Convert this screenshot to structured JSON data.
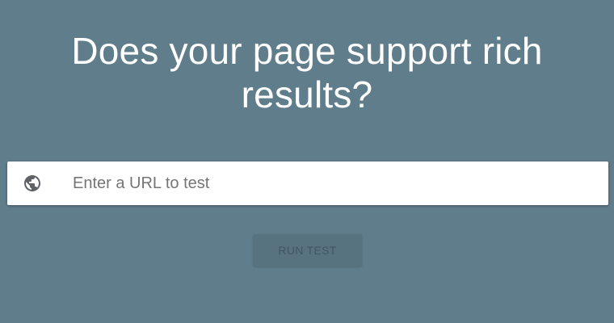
{
  "hero": {
    "title": "Does your page support rich results?"
  },
  "url_bar": {
    "icon": "globe-icon",
    "value": "",
    "placeholder": "Enter a URL to test"
  },
  "run_button": {
    "label": "RUN TEST",
    "state": "disabled"
  },
  "colors": {
    "background": "#607d8b",
    "input_background": "#ffffff",
    "icon": "#5f6368",
    "button_background": "#587380",
    "button_text": "#3f5763"
  }
}
